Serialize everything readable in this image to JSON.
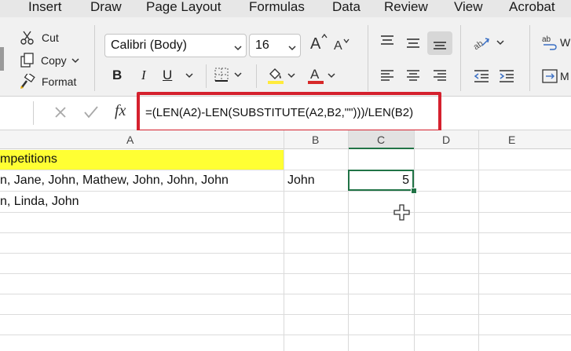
{
  "tabs": [
    "Insert",
    "Draw",
    "Page Layout",
    "Formulas",
    "Data",
    "Review",
    "View",
    "Acrobat"
  ],
  "clipboard": {
    "cut": "Cut",
    "copy": "Copy",
    "format": "Format"
  },
  "font": {
    "name": "Calibri (Body)",
    "size": "16",
    "bold": "B",
    "italic": "I",
    "underline": "U"
  },
  "wrap_partial": "W",
  "merge_partial": "M",
  "formula_bar": {
    "fx": "fx",
    "formula": "=(LEN(A2)-LEN(SUBSTITUTE(A2,B2,\"\")))/LEN(B2)"
  },
  "columns": [
    "A",
    "B",
    "C",
    "D",
    "E"
  ],
  "cells": {
    "a1": "mpetitions",
    "a2": "n, Jane, John, Mathew, John, John, John",
    "b2": "John",
    "c2": "5",
    "a3": "n, Linda, John"
  },
  "colors": {
    "highlight": "#ffff33",
    "selection": "#217346",
    "annotation": "#d5212e",
    "font_color": "#d62828",
    "fill_color": "#ffeb3b"
  }
}
